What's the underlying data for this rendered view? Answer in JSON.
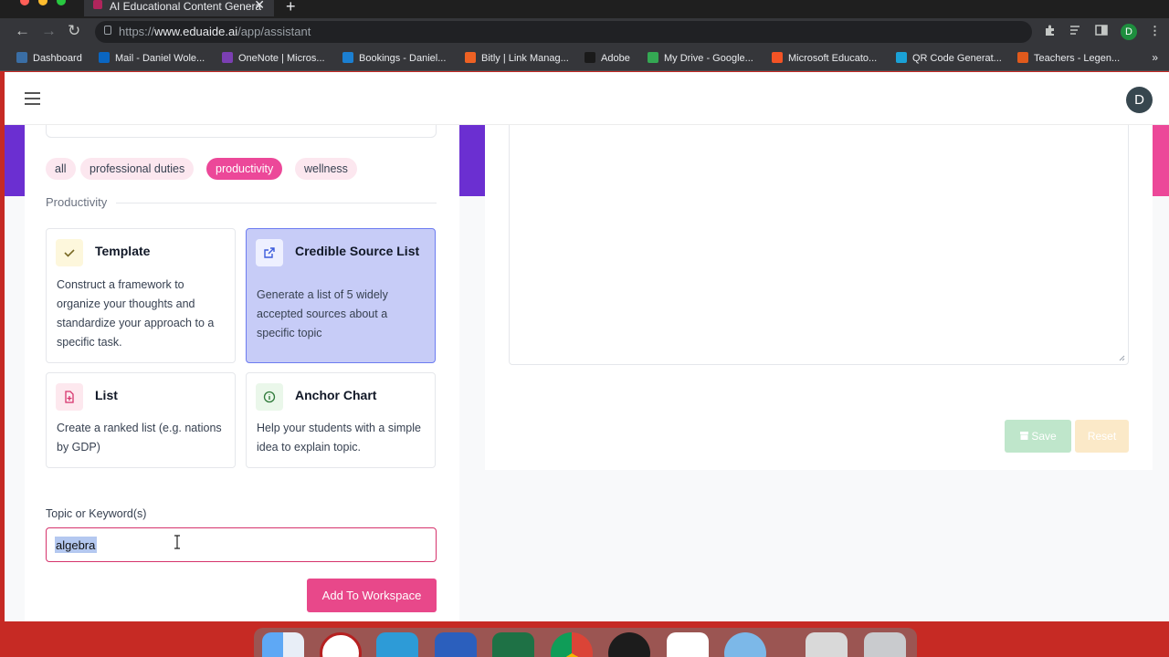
{
  "browser": {
    "tab_title": "AI Educational Content Genera",
    "url_prefix": "https://",
    "url_domain": "www.eduaide.ai",
    "url_path": "/app/assistant",
    "profile_initial": "D",
    "bookmarks": [
      {
        "label": "Dashboard",
        "color": "#3a6ea5"
      },
      {
        "label": "Mail - Daniel Wole...",
        "color": "#0a66c2"
      },
      {
        "label": "OneNote | Micros...",
        "color": "#7b3fb3"
      },
      {
        "label": "Bookings - Daniel...",
        "color": "#1b7fd1"
      },
      {
        "label": "Bitly | Link Manag...",
        "color": "#ee6123"
      },
      {
        "label": "Adobe",
        "color": "#1a1a1a"
      },
      {
        "label": "My Drive - Google...",
        "color": "#34a853"
      },
      {
        "label": "Microsoft Educato...",
        "color": "#f35325"
      },
      {
        "label": "QR Code Generat...",
        "color": "#1aa1d6"
      },
      {
        "label": "Teachers - Legen...",
        "color": "#e05a1c"
      }
    ],
    "more_bookmarks": "»"
  },
  "header": {
    "user_initial": "D"
  },
  "filters": {
    "chips": [
      "all",
      "professional duties",
      "productivity",
      "wellness"
    ],
    "active": "productivity"
  },
  "section": {
    "label": "Productivity"
  },
  "cards": [
    {
      "title": "Template",
      "description": "Construct a framework to organize your thoughts and standardize your approach to a specific task.",
      "icon": "check-icon",
      "selected": false
    },
    {
      "title": "Credible Source List",
      "description": "Generate a list of 5 widely accepted sources about a specific topic",
      "icon": "external-link-icon",
      "selected": true
    },
    {
      "title": "List",
      "description": "Create a ranked list (e.g. nations by GDP)",
      "icon": "file-plus-icon",
      "selected": false
    },
    {
      "title": "Anchor Chart",
      "description": "Help your students with a simple idea to explain topic.",
      "icon": "info-icon",
      "selected": false
    }
  ],
  "topic": {
    "label": "Topic or Keyword(s)",
    "value": "algebra"
  },
  "actions": {
    "add": "Add To Workspace",
    "save": "Save",
    "reset": "Reset"
  },
  "colors": {
    "accent_pink": "#e8488a",
    "accent_purple": "#6b2fd1",
    "selected_card": "#c7ccf7"
  }
}
